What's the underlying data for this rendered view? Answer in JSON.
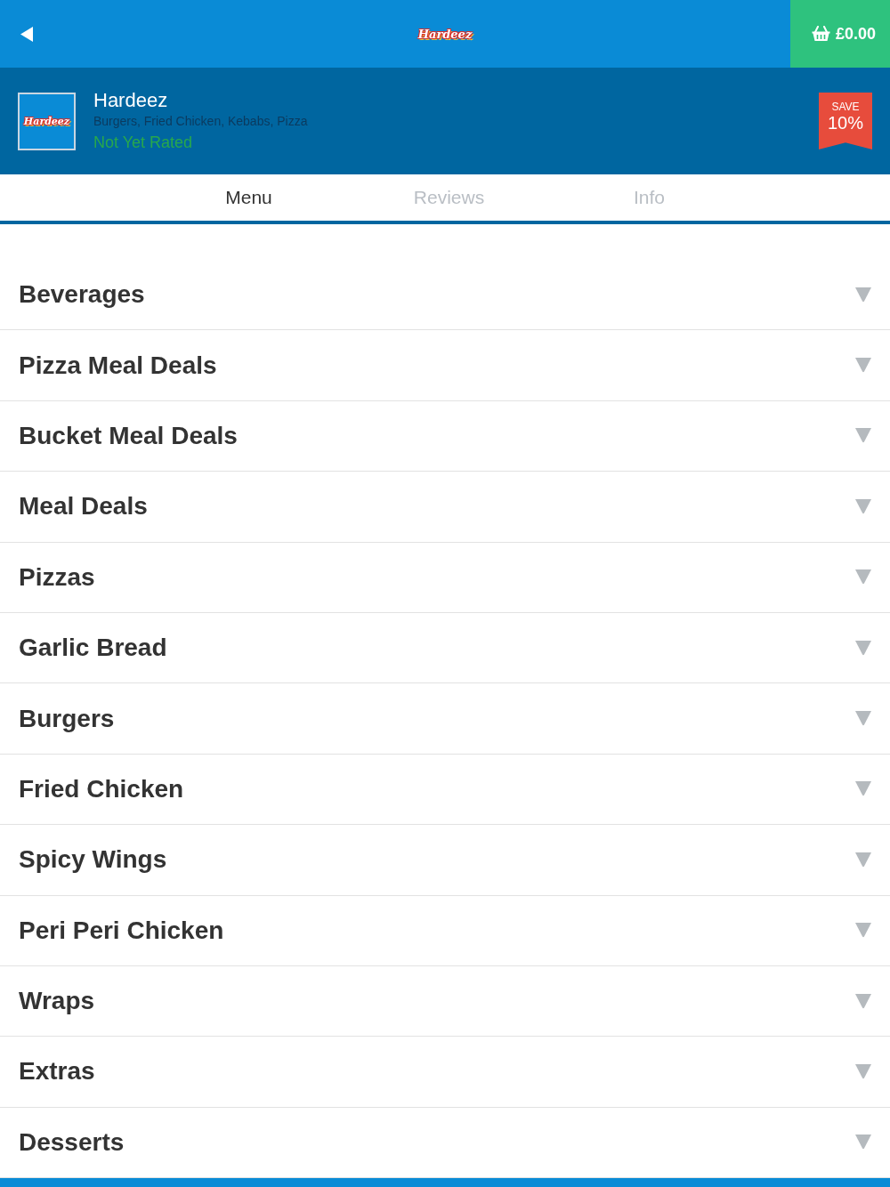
{
  "top_bar": {
    "logo_text": "Hardeez",
    "basket_total": "£0.00"
  },
  "restaurant": {
    "logo_text": "Hardeez",
    "name": "Hardeez",
    "cuisines": "Burgers, Fried Chicken, Kebabs, Pizza",
    "rating": "Not Yet Rated",
    "discount": {
      "label": "SAVE",
      "value": "10%"
    }
  },
  "tabs": [
    {
      "label": "Menu",
      "selected": true
    },
    {
      "label": "Reviews",
      "selected": false
    },
    {
      "label": "Info",
      "selected": false
    }
  ],
  "categories": [
    {
      "name": "Beverages",
      "expanded": false
    },
    {
      "name": "Pizza Meal Deals",
      "expanded": false
    },
    {
      "name": "Bucket Meal Deals",
      "expanded": false
    },
    {
      "name": "Meal Deals",
      "expanded": false
    },
    {
      "name": "Pizzas",
      "expanded": false
    },
    {
      "name": "Garlic Bread",
      "expanded": false
    },
    {
      "name": "Burgers",
      "expanded": false
    },
    {
      "name": "Fried Chicken",
      "expanded": false
    },
    {
      "name": "Spicy Wings",
      "expanded": false
    },
    {
      "name": "Peri Peri Chicken",
      "expanded": false
    },
    {
      "name": "Wraps",
      "expanded": false
    },
    {
      "name": "Extras",
      "expanded": false
    },
    {
      "name": "Desserts",
      "expanded": false
    }
  ]
}
